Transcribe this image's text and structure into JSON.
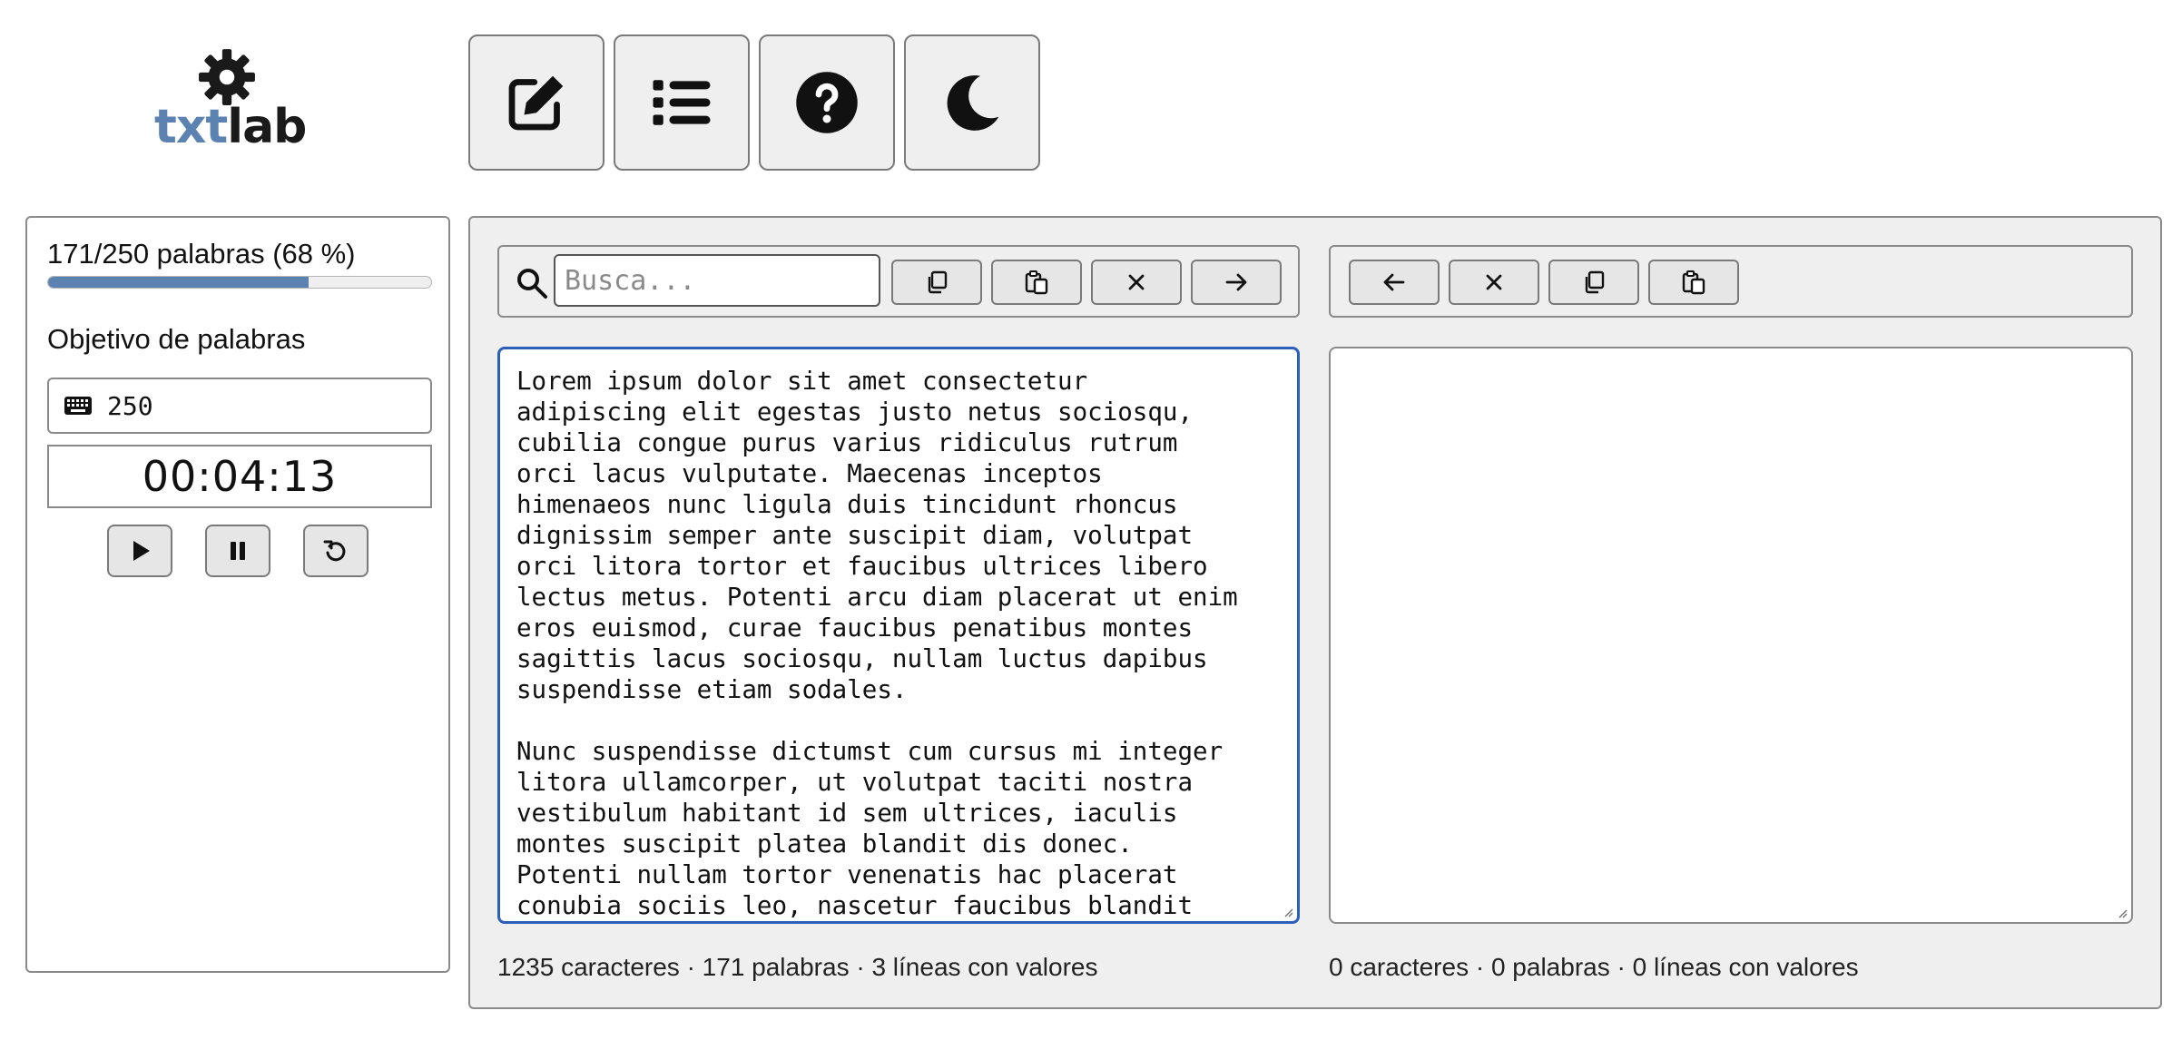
{
  "logo": {
    "part1": "txt",
    "part2": "lab"
  },
  "topbar": {
    "buttons": [
      {
        "name": "edit-button",
        "icon": "edit-icon"
      },
      {
        "name": "list-button",
        "icon": "list-icon"
      },
      {
        "name": "help-button",
        "icon": "question-circle-icon"
      },
      {
        "name": "dark-mode-button",
        "icon": "moon-icon"
      }
    ]
  },
  "sidebar": {
    "progress_label": "171/250 palabras (68 %)",
    "progress_fraction": 0.68,
    "goal_label": "Objetivo de palabras",
    "goal_value": "250",
    "timer": "00:04:13"
  },
  "editor": {
    "search_placeholder": "Busca...",
    "input_text": "Lorem ipsum dolor sit amet consectetur\nadipiscing elit egestas justo netus sociosqu,\ncubilia congue purus varius ridiculus rutrum\norci lacus vulputate. Maecenas inceptos\nhimenaeos nunc ligula duis tincidunt rhoncus\ndignissim semper ante suscipit diam, volutpat\norci litora tortor et faucibus ultrices libero\nlectus metus. Potenti arcu diam placerat ut enim\neros euismod, curae faucibus penatibus montes\nsagittis lacus sociosqu, nullam luctus dapibus\nsuspendisse etiam sodales.\n\nNunc suspendisse dictumst cum cursus mi integer\nlitora ullamcorper, ut volutpat taciti nostra\nvestibulum habitant id sem ultrices, iaculis\nmontes suscipit platea blandit dis donec.\nPotenti nullam tortor venenatis hac placerat\nconubia sociis leo, nascetur faucibus blandit",
    "output_text": "",
    "stats_left": "1235 caracteres · 171 palabras · 3 líneas con valores",
    "stats_right": "0 caracteres · 0 palabras · 0 líneas con valores"
  },
  "colors": {
    "accent": "#5b82b0",
    "focus": "#2c5fb8"
  }
}
